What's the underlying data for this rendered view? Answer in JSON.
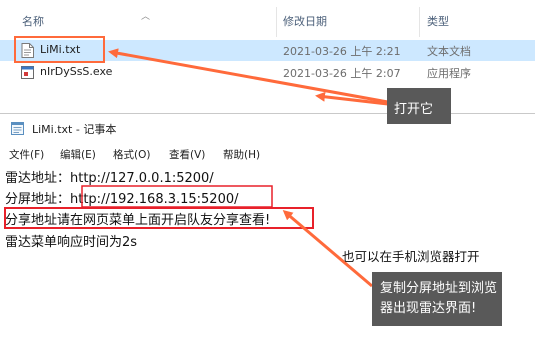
{
  "explorer": {
    "columns": {
      "name": "名称",
      "date": "修改日期",
      "type": "类型"
    },
    "files": [
      {
        "name": "LiMi.txt",
        "date": "2021-03-26 上午 2:21",
        "type": "文本文档",
        "icon": "text-file-icon"
      },
      {
        "name": "nIrDySsS.exe",
        "date": "2021-03-26 上午 2:07",
        "type": "应用程序",
        "icon": "exe-file-icon"
      }
    ]
  },
  "notepad": {
    "title": "LiMi.txt - 记事本",
    "menu": [
      "文件(F)",
      "编辑(E)",
      "格式(O)",
      "查看(V)",
      "帮助(H)"
    ],
    "lines": [
      "雷达地址：http://127.0.0.1:5200/",
      "分屏地址：http://192.168.3.15:5200/",
      "分享地址请在网页菜单上面开启队友分享查看!",
      "雷达菜单响应时间为2s"
    ]
  },
  "annotations": {
    "open_it": "打开它",
    "browser_note": "也可以在手机浏览器打开",
    "copy_note": "复制分屏地址到浏览器出现雷达界面!",
    "highlight_color": "#ff6a3b",
    "red_box_color": "#e8212a",
    "callout_bg": "#595959"
  },
  "colors": {
    "selected_row": "#cde8ff",
    "header_text": "#4c607a"
  }
}
